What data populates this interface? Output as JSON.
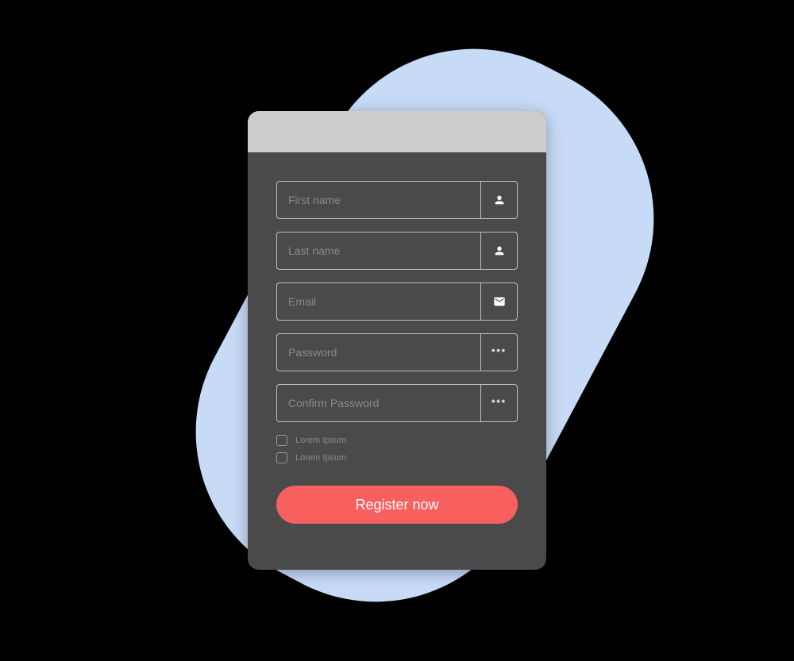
{
  "form": {
    "fields": {
      "first_name": {
        "placeholder": "First name",
        "value": "",
        "icon": "user"
      },
      "last_name": {
        "placeholder": "Last name",
        "value": "",
        "icon": "user"
      },
      "email": {
        "placeholder": "Email",
        "value": "",
        "icon": "envelope"
      },
      "password": {
        "placeholder": "Password",
        "value": "",
        "icon_text": "***"
      },
      "confirm_password": {
        "placeholder": "Confirm Password",
        "value": "",
        "icon_text": "***"
      }
    },
    "checkboxes": [
      {
        "label": "Lorem Ipsum",
        "checked": false
      },
      {
        "label": "Lorem Ipsum",
        "checked": false
      }
    ],
    "submit_label": "Register now"
  },
  "colors": {
    "accent": "#f86060",
    "card_bg": "#4a4a4a",
    "header_bg": "#cccccc",
    "blob": "#c7dbf7"
  }
}
